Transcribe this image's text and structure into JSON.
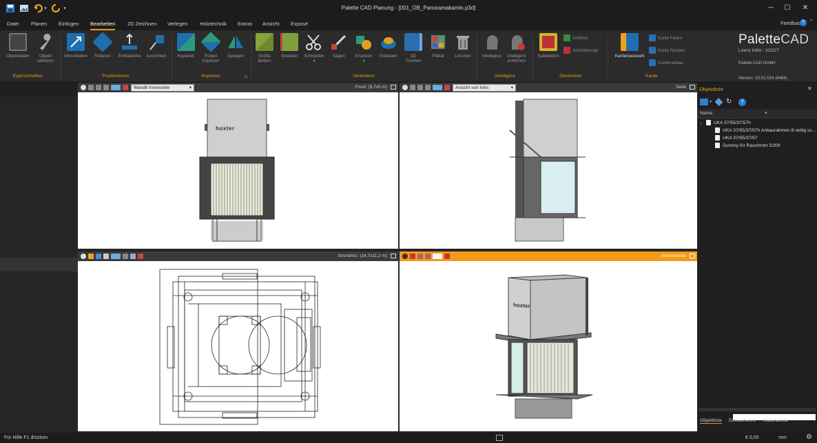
{
  "window": {
    "title": "Palette CAD Planung - [001_OB_Panoramakamin.p3d]"
  },
  "menu": {
    "items": [
      "Datei",
      "Planen",
      "Einfügen",
      "Bearbeiten",
      "2D Zeichnen",
      "Verlegen",
      "Holztechnik",
      "Extras",
      "Ansicht",
      "Exposé"
    ],
    "active": "Bearbeiten",
    "feedback": "Feedback"
  },
  "ribbon": {
    "buttons": {
      "objektdaten": "Objektdaten",
      "objekt_edit_1": "Objekt",
      "objekt_edit_2": "editieren",
      "verschieben": "Verschieben",
      "rotieren": "Rotieren",
      "einbauhoehe": "Einbauhöhe",
      "ausrichten": "Ausrichten",
      "kopieren": "Kopieren",
      "rotiert_1": "Rotiert",
      "rotiert_2": "Kopieren",
      "spiegeln": "Spiegeln",
      "groesse_1": "Größe",
      "groesse_2": "ändern",
      "strecken": "Strecken",
      "schneiden": "Schneiden",
      "saegen": "Sägen",
      "ersetzen": "Ersetzen",
      "einbauen": "Einbauen",
      "trennen_1": "3D",
      "trennen_2": "Trennen",
      "plakat": "Plakat",
      "loeschen": "Löschen",
      "intelligenz": "Intelligenz",
      "intel_entf_1": "Intelligenz",
      "intel_entf_2": "entfernen",
      "subtraktion": "Subtraktion",
      "addition": "Addition",
      "schnittmenge": "Schnittmenge",
      "kantenauswahl": "Kantenauswahl",
      "kante_fasen": "Kante Fasen",
      "kante_runden": "Kante Runden",
      "kantenabbau": "Kantenabbau"
    },
    "groups": {
      "eigenschaften": "Eigenschaften",
      "positionieren": "Positionieren",
      "kopieren": "Kopieren",
      "veraendern": "Verändern",
      "intelligenz": "Intelligenz",
      "geometrie": "Geometrie",
      "kante": "Kante"
    },
    "brand": {
      "name_a": "Palette",
      "name_b": "CAD",
      "license": "Lizenz KdNr.: 102327",
      "company": "Palette CAD GmbH",
      "version": "Version: 10.01.024 (64bit)"
    }
  },
  "viewports": {
    "front": {
      "select": "Wand6 Innenseite",
      "label": "Front: (9,7x5 m)"
    },
    "side": {
      "select": "Ansicht von links",
      "label": "Seite"
    },
    "top": {
      "label": "Grundriss: (14,7x11,2 m)"
    },
    "iso": {
      "label": "Axonometrie"
    }
  },
  "model": {
    "logo": "hoxter"
  },
  "objektliste": {
    "title": "Objektliste",
    "col_name": "Name",
    "tree": [
      {
        "label": "UKA 37/55/37/57h",
        "level": 0
      },
      {
        "label": "UKA 37/55/37/57h Anbaurahmen 8-seitig sc...",
        "level": 1
      },
      {
        "label": "UKA 37/55/37/57",
        "level": 1
      },
      {
        "label": "Dummy für Rauchrohr D200",
        "level": 1
      }
    ],
    "tabs": [
      "Objektliste",
      "Einkaufskorb",
      "Materialliste"
    ]
  },
  "status": {
    "help": "Für Hilfe F1 drücken",
    "price": "€ 0,00",
    "unit": "mm"
  },
  "colors": {
    "accent": "#e89a1c",
    "active_viewport": "#f39a18",
    "ribbon_blue": "#1e6fae"
  }
}
